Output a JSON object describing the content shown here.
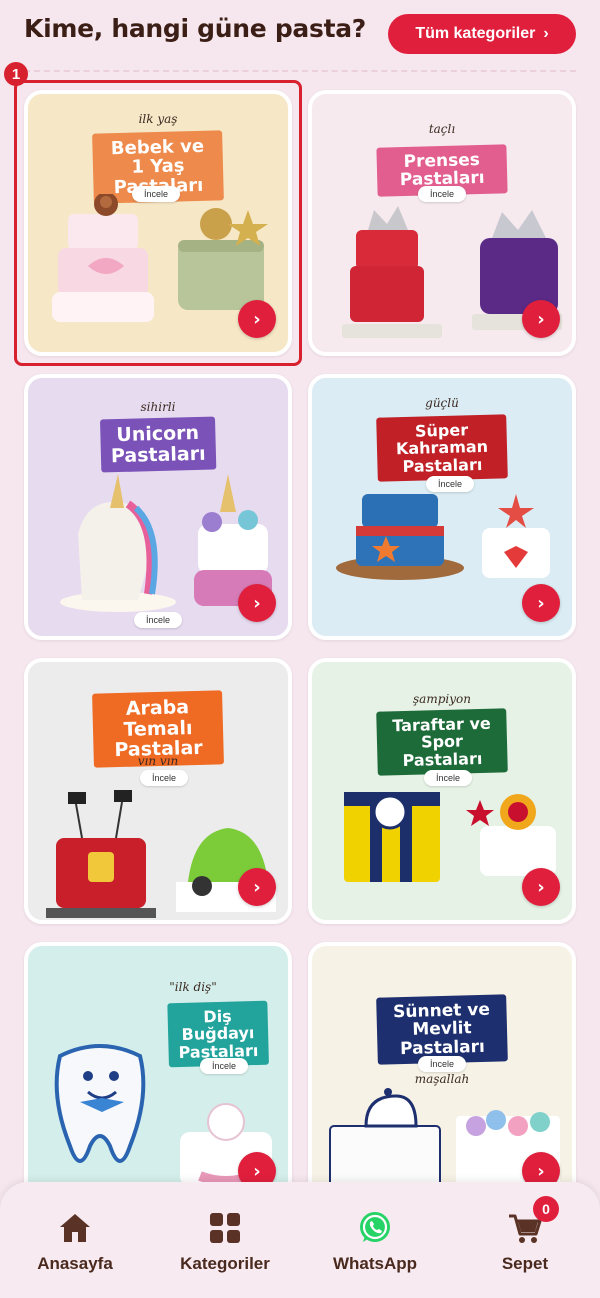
{
  "header": {
    "title": "Kime, hangi güne pasta?",
    "all_categories_label": "Tüm kategoriler",
    "chevron": "›"
  },
  "highlight": {
    "badge": "1"
  },
  "cards": [
    {
      "small_label": "ilk yaş",
      "title": "Bebek ve 1 Yaş\nPastaları",
      "button": "İncele",
      "go": "›",
      "bg": "#f6e7c6",
      "banner_color": "#ee8a4b"
    },
    {
      "small_label": "taçlı",
      "title": "Prenses Pastaları",
      "button": "İncele",
      "go": "›",
      "bg": "#f6eaee",
      "banner_color": "#e25e8e"
    },
    {
      "small_label": "sihirli",
      "title": "Unicorn\nPastaları",
      "button": "İncele",
      "go": "›",
      "bg": "#e7dbf0",
      "banner_color": "#7a52b8"
    },
    {
      "small_label": "güçlü",
      "title": "Süper Kahraman\nPastaları",
      "button": "İncele",
      "go": "›",
      "bg": "#dbecf4",
      "banner_color": "#c02026"
    },
    {
      "small_label": "vın vın",
      "title": "Araba Temalı\nPastalar",
      "button": "İncele",
      "go": "›",
      "bg": "#ececec",
      "banner_color": "#ef6a22"
    },
    {
      "small_label": "şampiyon",
      "title": "Taraftar ve Spor\nPastaları",
      "button": "İncele",
      "go": "›",
      "bg": "#e6f2e6",
      "banner_color": "#1e6b3a"
    },
    {
      "small_label": "\"ilk diş\"",
      "title": "Diş Buğdayı\nPastaları",
      "button": "İncele",
      "go": "›",
      "bg": "#d4efeb",
      "banner_color": "#22a39b"
    },
    {
      "small_label": "maşallah",
      "title": "Sünnet ve\nMevlit Pastaları",
      "button": "İncele",
      "go": "›",
      "bg": "#f7f2e6",
      "banner_color": "#1d2f6e"
    }
  ],
  "bottom_nav": {
    "items": [
      {
        "label": "Anasayfa",
        "icon": "home-icon"
      },
      {
        "label": "Kategoriler",
        "icon": "grid-icon"
      },
      {
        "label": "WhatsApp",
        "icon": "whatsapp-icon"
      },
      {
        "label": "Sepet",
        "icon": "cart-icon"
      }
    ],
    "cart_count": "0"
  },
  "colors": {
    "accent": "#e01f3d",
    "page_bg": "#f6e6ee",
    "whatsapp": "#25d366"
  }
}
